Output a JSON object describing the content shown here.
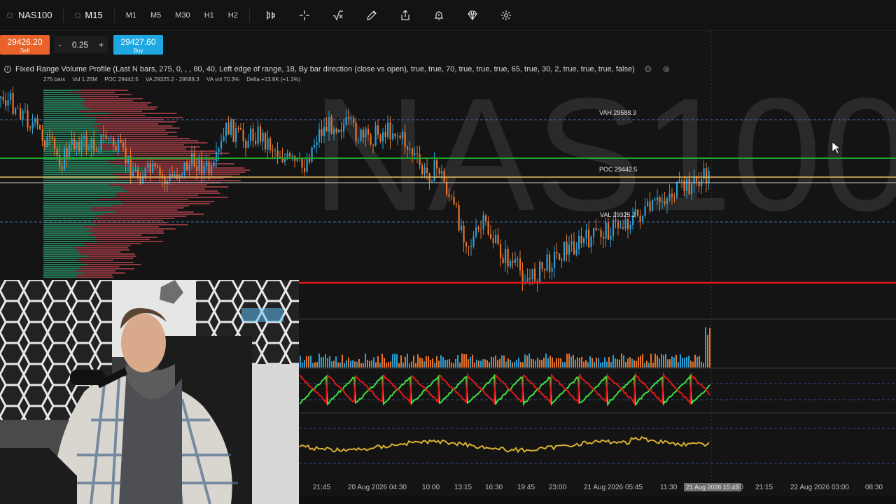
{
  "toolbar": {
    "symbol": "NAS100",
    "active_timeframe": "M15",
    "timeframes": [
      "M1",
      "M5",
      "M30",
      "H1",
      "H2"
    ],
    "tool_icons": [
      "indicators-icon",
      "crosshair-icon",
      "formula-icon",
      "pencil-icon",
      "share-icon",
      "alert-icon",
      "diamond-icon",
      "settings-icon"
    ]
  },
  "trade": {
    "sell_price": "29426.20",
    "sell_label": "Sell",
    "buy_price": "29427.60",
    "buy_label": "Buy",
    "qty": "0.25",
    "minus": "-",
    "plus": "+"
  },
  "legend": {
    "title": "Fixed Range Volume Profile (Last N bars, 275, 0, , , 80, 40, Left edge of range, 18, By bar direction (close vs open), true, true, 70, true, true, true, 65, true, 30, 2, true, true, true, false)",
    "bars": "275 bars",
    "vol": "Vol 1.25M",
    "poc": "POC 29442.5",
    "va": "VA 29325.2 - 29588.3",
    "va_vol": "VA vol 70.3%",
    "delta": "Delta +13.8K (+1.1%)"
  },
  "levels": {
    "vah": "VAH 29588.3",
    "poc": "POC 29442.5",
    "val": "VAL 29325.2"
  },
  "watermark": "NAS100",
  "time_axis": {
    "ticks": [
      "21:45",
      "20 Aug 2026 04:30",
      "10:00",
      "13:15",
      "16:30",
      "19:45",
      "23:00",
      "21 Aug 2026 05:45",
      "11:30",
      "21 Aug 2026 15:45",
      "20",
      "21:15",
      "22 Aug 2026 03:00",
      "08:30"
    ],
    "highlighted": "21 Aug 2026 15:45"
  },
  "colors": {
    "bull": "#2a9fd6",
    "bear": "#e8742a",
    "vah_val_line": "#4a6fae",
    "poc_line": "#e8c060",
    "green_level": "#1fa82a",
    "red_level": "#e01818",
    "osc_green": "#3fe03f",
    "osc_red": "#e01818",
    "osc_yellow": "#d8b030"
  }
}
